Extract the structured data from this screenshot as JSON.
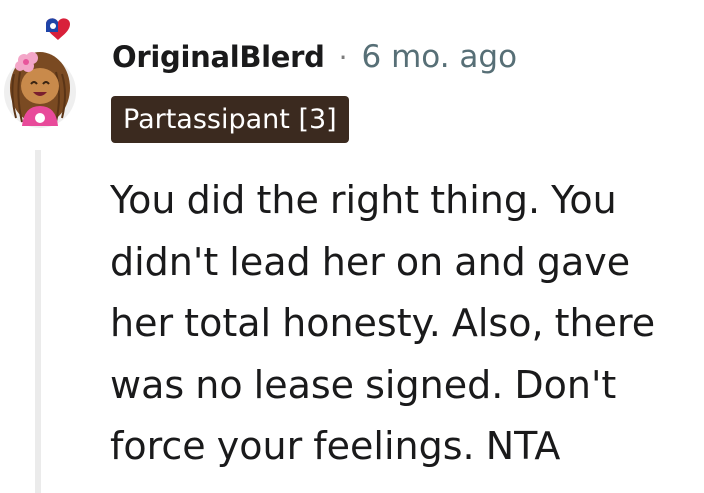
{
  "comment": {
    "username": "OriginalBlerd",
    "separator": "·",
    "timestamp": "6 mo. ago",
    "flair": "Partassipant [3]",
    "body": "You did the right thing. You didn't lead her on and gave her total honesty. Also, there was no lease signed. Don't force your feelings. NTA"
  },
  "colors": {
    "flair_background": "#3b2a1f",
    "flair_text": "#ffffff",
    "username": "#1a1a1b",
    "timestamp": "#576f76",
    "thread_line": "#ebebeb",
    "avatar_background": "#f0f0f0"
  },
  "icons": {
    "avatar": "snoo-avatar-icon",
    "avatar_accessory": "heart-flag-icon"
  }
}
